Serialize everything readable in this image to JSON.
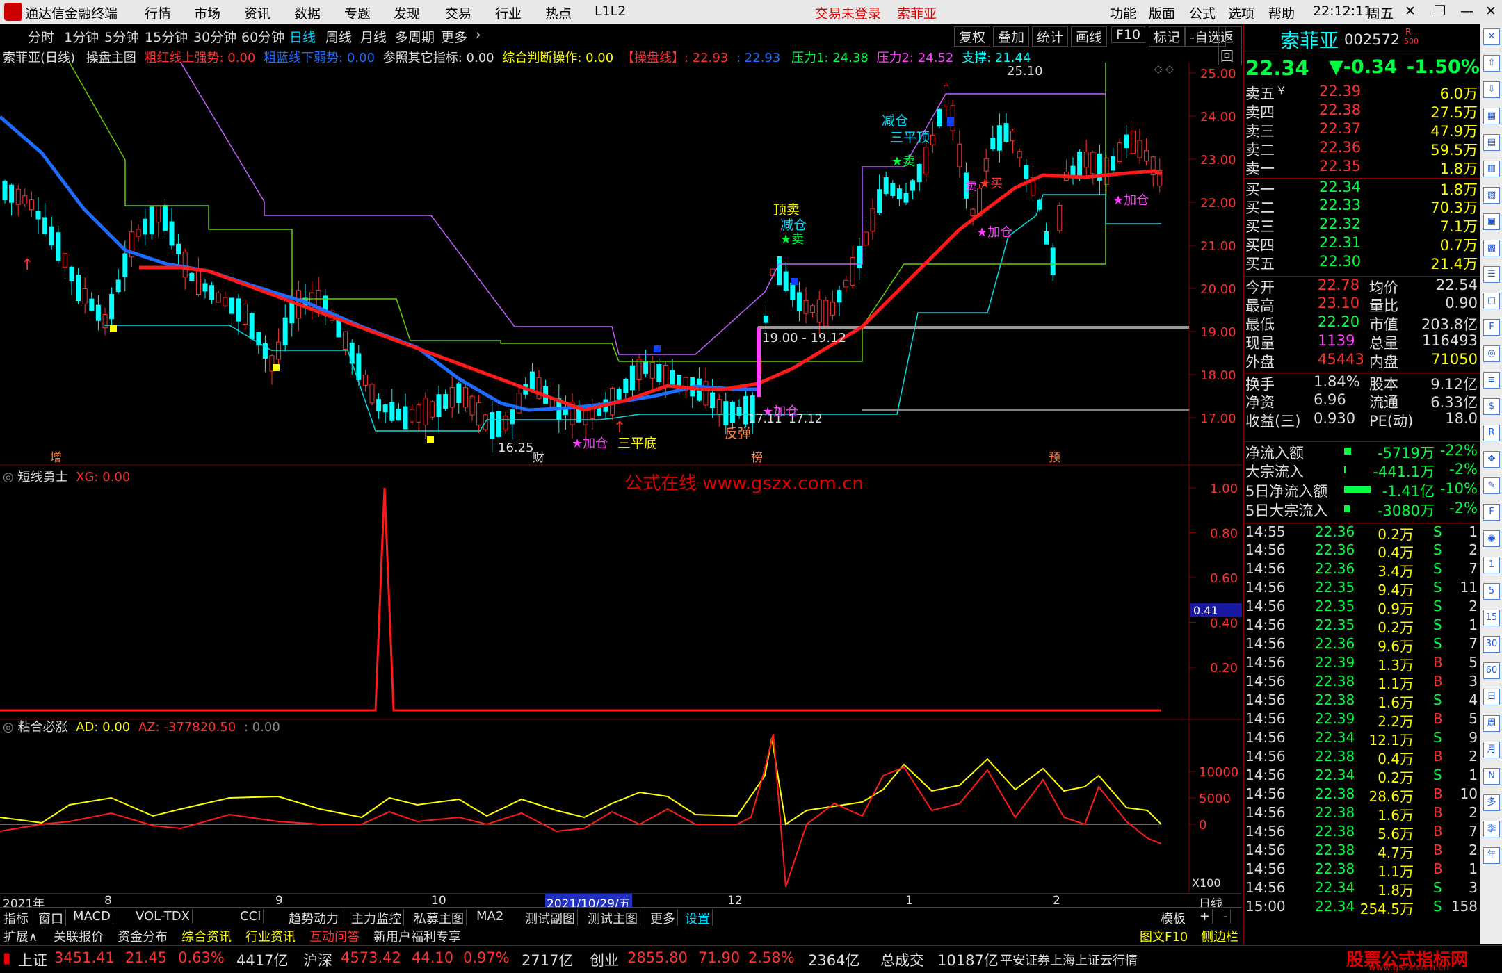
{
  "titlebar": {
    "app_name": "通达信金融终端",
    "menus": [
      "行情",
      "市场",
      "资讯",
      "数据",
      "专题",
      "发现",
      "交易",
      "行业",
      "热点",
      "L1L2"
    ],
    "login_status": "交易未登录",
    "stock_name": "索菲亚",
    "right_menus": [
      "功能",
      "版面",
      "公式",
      "选项",
      "帮助"
    ],
    "time": "22:12:11",
    "weekday": "周五"
  },
  "periodbar": {
    "items": [
      "分时",
      "1分钟",
      "5分钟",
      "15分钟",
      "30分钟",
      "60分钟",
      "日线",
      "周线",
      "月线",
      "多周期",
      "更多"
    ],
    "active": "日线",
    "buttons": [
      "复权",
      "叠加",
      "统计",
      "画线",
      "F10",
      "标记",
      "-自选",
      "返回"
    ]
  },
  "main_header": {
    "title": "索菲亚(日线)",
    "formula": "操盘主图",
    "i1": "粗红线上强势: 0.00",
    "i2": "粗蓝线下弱势: 0.00",
    "i3": "参照其它指标: 0.00",
    "i4": "综合判断操作: 0.00",
    "i5": "【操盘线】: 22.93",
    "i6": ": 22.93",
    "i7": "压力1: 24.38",
    "i8": "压力2: 24.52",
    "i9": "支撑: 21.44"
  },
  "main_axis": [
    "25.00",
    "24.00",
    "23.00",
    "22.00",
    "21.00",
    "20.00",
    "19.00",
    "18.00",
    "17.00"
  ],
  "annotations": {
    "high_label": "25.10",
    "low_label": "16.25",
    "range_label": "19.00 - 19.12",
    "low2_label": "17.11",
    "low3_label": "17.12",
    "top_sell": "顶卖",
    "reduce1": "减仓",
    "sell1": "★卖",
    "reduce2": "减仓",
    "triple_top": "三平顶",
    "sell2": "★卖",
    "add1": "★加仓",
    "triple_bottom": "三平底",
    "rebound": "反弹",
    "add2": "★加仓",
    "add3": "★加仓",
    "add4": "★加仓",
    "buy": "★买",
    "tag1": "增",
    "tag2": "财",
    "tag3": "榜",
    "tag4": "预",
    "tag5": "卖"
  },
  "sub1": {
    "title": "短线勇士",
    "value": "XG: 0.00",
    "axis": [
      "1.00",
      "0.80",
      "0.60",
      "0.40",
      "0.20"
    ],
    "cursor_value": "0.41",
    "watermark": "公式在线  www.gszx.com.cn"
  },
  "sub2": {
    "title": "粘合必涨",
    "ad": "AD: 0.00",
    "az": "AZ: -377820.50",
    "extra": ": 0.00",
    "axis": [
      "10000",
      "5000",
      "0"
    ],
    "scale": "X100"
  },
  "time_axis": [
    "2021年",
    "8",
    "9",
    "10",
    "2021/10/29/五",
    "12",
    "1",
    "2",
    "日线"
  ],
  "quote": {
    "name": "索菲亚",
    "code": "002572",
    "price": "22.34",
    "change": "▼-0.34",
    "pct": "-1.50%",
    "asks": [
      {
        "label": "卖五",
        "mark": "￥",
        "price": "22.39",
        "vol": "6.0万"
      },
      {
        "label": "卖四",
        "mark": "",
        "price": "22.38",
        "vol": "27.5万"
      },
      {
        "label": "卖三",
        "mark": "",
        "price": "22.37",
        "vol": "47.9万"
      },
      {
        "label": "卖二",
        "mark": "",
        "price": "22.36",
        "vol": "59.5万"
      },
      {
        "label": "卖一",
        "mark": "",
        "price": "22.35",
        "vol": "1.8万"
      }
    ],
    "bids": [
      {
        "label": "买一",
        "price": "22.34",
        "vol": "1.8万"
      },
      {
        "label": "买二",
        "price": "22.33",
        "vol": "70.3万"
      },
      {
        "label": "买三",
        "price": "22.32",
        "vol": "7.1万"
      },
      {
        "label": "买四",
        "price": "22.31",
        "vol": "0.7万"
      },
      {
        "label": "买五",
        "price": "22.30",
        "vol": "21.4万"
      }
    ],
    "stats": [
      {
        "k1": "今开",
        "v1": "22.78",
        "k2": "均价",
        "v2": "22.54",
        "c1": "#ff3030",
        "c2": "#ddd"
      },
      {
        "k1": "最高",
        "v1": "23.10",
        "k2": "量比",
        "v2": "0.90",
        "c1": "#ff3030",
        "c2": "#ddd"
      },
      {
        "k1": "最低",
        "v1": "22.20",
        "k2": "市值",
        "v2": "203.8亿",
        "c1": "#00ff40",
        "c2": "#ddd"
      },
      {
        "k1": "现量",
        "v1": "1139",
        "k2": "总量",
        "v2": "116493",
        "c1": "#ff40ff",
        "c2": "#ddd"
      },
      {
        "k1": "外盘",
        "v1": "45443",
        "k2": "内盘",
        "v2": "71050",
        "c1": "#ff3030",
        "c2": "#ffff00"
      }
    ],
    "stats2": [
      {
        "k1": "换手",
        "v1": "1.84%",
        "k2": "股本",
        "v2": "9.12亿"
      },
      {
        "k1": "净资",
        "v1": "6.96",
        "k2": "流通",
        "v2": "6.33亿"
      },
      {
        "k1": "收益(三)",
        "v1": "0.930",
        "k2": "PE(动)",
        "v2": "18.0"
      }
    ],
    "flows": [
      {
        "k": "净流入额",
        "v": "-5719万",
        "p": "-22%"
      },
      {
        "k": "大宗流入",
        "v": "-441.1万",
        "p": "-2%"
      },
      {
        "k": "5日净流入额",
        "v": "-1.41亿",
        "p": "-10%"
      },
      {
        "k": "5日大宗流入",
        "v": "-3080万",
        "p": "-2%"
      }
    ],
    "ticks": [
      {
        "t": "14:55",
        "p": "22.36",
        "v": "0.2万",
        "s": "S",
        "n": "1"
      },
      {
        "t": "14:56",
        "p": "22.36",
        "v": "0.4万",
        "s": "S",
        "n": "2"
      },
      {
        "t": "14:56",
        "p": "22.36",
        "v": "3.4万",
        "s": "S",
        "n": "7"
      },
      {
        "t": "14:56",
        "p": "22.35",
        "v": "9.4万",
        "s": "S",
        "n": "11"
      },
      {
        "t": "14:56",
        "p": "22.35",
        "v": "0.9万",
        "s": "S",
        "n": "2"
      },
      {
        "t": "14:56",
        "p": "22.35",
        "v": "0.2万",
        "s": "S",
        "n": "1"
      },
      {
        "t": "14:56",
        "p": "22.36",
        "v": "9.6万",
        "s": "S",
        "n": "7"
      },
      {
        "t": "14:56",
        "p": "22.39",
        "v": "1.3万",
        "s": "B",
        "n": "5"
      },
      {
        "t": "14:56",
        "p": "22.38",
        "v": "1.1万",
        "s": "B",
        "n": "3"
      },
      {
        "t": "14:56",
        "p": "22.38",
        "v": "1.6万",
        "s": "S",
        "n": "4"
      },
      {
        "t": "14:56",
        "p": "22.39",
        "v": "2.2万",
        "s": "B",
        "n": "5"
      },
      {
        "t": "14:56",
        "p": "22.34",
        "v": "12.1万",
        "s": "S",
        "n": "9"
      },
      {
        "t": "14:56",
        "p": "22.38",
        "v": "0.4万",
        "s": "B",
        "n": "2"
      },
      {
        "t": "14:56",
        "p": "22.34",
        "v": "0.2万",
        "s": "S",
        "n": "1"
      },
      {
        "t": "14:56",
        "p": "22.38",
        "v": "28.6万",
        "s": "B",
        "n": "10"
      },
      {
        "t": "14:56",
        "p": "22.38",
        "v": "1.6万",
        "s": "B",
        "n": "2"
      },
      {
        "t": "14:56",
        "p": "22.38",
        "v": "5.6万",
        "s": "B",
        "n": "7"
      },
      {
        "t": "14:56",
        "p": "22.38",
        "v": "4.7万",
        "s": "B",
        "n": "2"
      },
      {
        "t": "14:56",
        "p": "22.38",
        "v": "1.1万",
        "s": "B",
        "n": "1"
      },
      {
        "t": "14:56",
        "p": "22.34",
        "v": "1.8万",
        "s": "S",
        "n": "3"
      },
      {
        "t": "15:00",
        "p": "22.34",
        "v": "254.5万",
        "s": "S",
        "n": "158"
      }
    ]
  },
  "tabs": [
    "指标",
    "窗口",
    "MACD",
    "VOL-TDX",
    "CCI",
    "趋势动力",
    "主力监控",
    "私募主图",
    "MA2",
    "测试副图",
    "测试主图",
    "更多",
    "设置"
  ],
  "tabs_right": [
    "模板",
    "+",
    "-"
  ],
  "tabs2": [
    "扩展∧",
    "关联报价",
    "资金分布",
    "综合资讯",
    "行业资讯",
    "互动问答",
    "新用户福利专享"
  ],
  "tabs2_right": [
    "图文F10",
    "侧边栏《",
    "笔",
    "价",
    "细",
    "势"
  ],
  "status": {
    "sh_label": "上证",
    "sh_val": "3451.41",
    "sh_chg": "21.45",
    "sh_pct": "0.63%",
    "sh_amt": "4417亿",
    "sz_label": "沪深",
    "sz_val": "4573.42",
    "sz_chg": "44.10",
    "sz_pct": "0.97%",
    "sz_amt": "2717亿",
    "cy_label": "创业",
    "cy_val": "2855.80",
    "cy_chg": "71.90",
    "cy_pct": "2.58%",
    "cy_amt": "2364亿",
    "total_label": "总成交",
    "total_val": "10187亿",
    "broker": "平安证券上海上证云行情",
    "brand": "股票公式指标网",
    "brand_url": "www.gszx.com.cn"
  },
  "colors": {
    "up": "#ff3030",
    "down": "#00ffff",
    "ma_blue": "#1e6cff",
    "ma_red": "#ff1a1a",
    "accent": "#00d0ff"
  }
}
